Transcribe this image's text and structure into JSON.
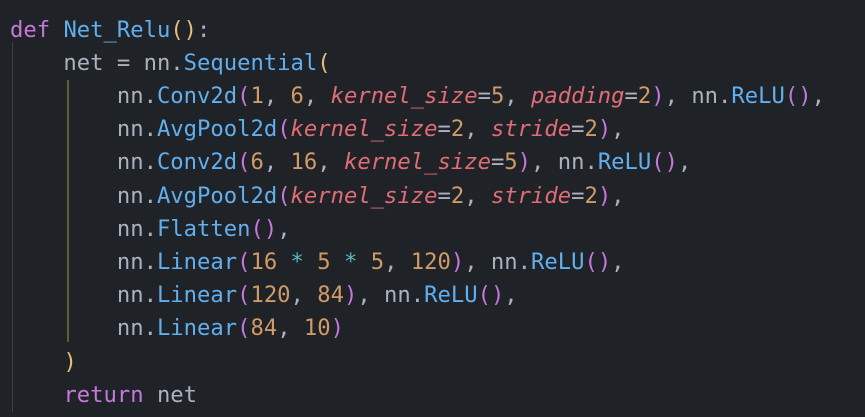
{
  "code": {
    "lines": [
      [
        {
          "t": "def",
          "c": "kw"
        },
        {
          "t": " ",
          "c": "id"
        },
        {
          "t": "Net_Relu",
          "c": "fn"
        },
        {
          "t": "(",
          "c": "b1"
        },
        {
          "t": ")",
          "c": "b1"
        },
        {
          "t": ":",
          "c": "punc"
        }
      ],
      [
        {
          "t": "    net = nn.",
          "c": "id"
        },
        {
          "t": "Sequential",
          "c": "fn"
        },
        {
          "t": "(",
          "c": "b1"
        }
      ],
      [
        {
          "t": "        nn.",
          "c": "id"
        },
        {
          "t": "Conv2d",
          "c": "fn"
        },
        {
          "t": "(",
          "c": "b2"
        },
        {
          "t": "1",
          "c": "num"
        },
        {
          "t": ", ",
          "c": "punc"
        },
        {
          "t": "6",
          "c": "num"
        },
        {
          "t": ", ",
          "c": "punc"
        },
        {
          "t": "kernel_size",
          "c": "kwarg"
        },
        {
          "t": "=",
          "c": "punc"
        },
        {
          "t": "5",
          "c": "num"
        },
        {
          "t": ", ",
          "c": "punc"
        },
        {
          "t": "padding",
          "c": "kwarg"
        },
        {
          "t": "=",
          "c": "punc"
        },
        {
          "t": "2",
          "c": "num"
        },
        {
          "t": ")",
          "c": "b2"
        },
        {
          "t": ", nn.",
          "c": "id"
        },
        {
          "t": "ReLU",
          "c": "fn"
        },
        {
          "t": "(",
          "c": "b2"
        },
        {
          "t": ")",
          "c": "b2"
        },
        {
          "t": ",",
          "c": "punc"
        }
      ],
      [
        {
          "t": "        nn.",
          "c": "id"
        },
        {
          "t": "AvgPool2d",
          "c": "fn"
        },
        {
          "t": "(",
          "c": "b2"
        },
        {
          "t": "kernel_size",
          "c": "kwarg"
        },
        {
          "t": "=",
          "c": "punc"
        },
        {
          "t": "2",
          "c": "num"
        },
        {
          "t": ", ",
          "c": "punc"
        },
        {
          "t": "stride",
          "c": "kwarg"
        },
        {
          "t": "=",
          "c": "punc"
        },
        {
          "t": "2",
          "c": "num"
        },
        {
          "t": ")",
          "c": "b2"
        },
        {
          "t": ",",
          "c": "punc"
        }
      ],
      [
        {
          "t": "        nn.",
          "c": "id"
        },
        {
          "t": "Conv2d",
          "c": "fn"
        },
        {
          "t": "(",
          "c": "b2"
        },
        {
          "t": "6",
          "c": "num"
        },
        {
          "t": ", ",
          "c": "punc"
        },
        {
          "t": "16",
          "c": "num"
        },
        {
          "t": ", ",
          "c": "punc"
        },
        {
          "t": "kernel_size",
          "c": "kwarg"
        },
        {
          "t": "=",
          "c": "punc"
        },
        {
          "t": "5",
          "c": "num"
        },
        {
          "t": ")",
          "c": "b2"
        },
        {
          "t": ", nn.",
          "c": "id"
        },
        {
          "t": "ReLU",
          "c": "fn"
        },
        {
          "t": "(",
          "c": "b2"
        },
        {
          "t": ")",
          "c": "b2"
        },
        {
          "t": ",",
          "c": "punc"
        }
      ],
      [
        {
          "t": "        nn.",
          "c": "id"
        },
        {
          "t": "AvgPool2d",
          "c": "fn"
        },
        {
          "t": "(",
          "c": "b2"
        },
        {
          "t": "kernel_size",
          "c": "kwarg"
        },
        {
          "t": "=",
          "c": "punc"
        },
        {
          "t": "2",
          "c": "num"
        },
        {
          "t": ", ",
          "c": "punc"
        },
        {
          "t": "stride",
          "c": "kwarg"
        },
        {
          "t": "=",
          "c": "punc"
        },
        {
          "t": "2",
          "c": "num"
        },
        {
          "t": ")",
          "c": "b2"
        },
        {
          "t": ",",
          "c": "punc"
        }
      ],
      [
        {
          "t": "        nn.",
          "c": "id"
        },
        {
          "t": "Flatten",
          "c": "fn"
        },
        {
          "t": "(",
          "c": "b2"
        },
        {
          "t": ")",
          "c": "b2"
        },
        {
          "t": ",",
          "c": "punc"
        }
      ],
      [
        {
          "t": "        nn.",
          "c": "id"
        },
        {
          "t": "Linear",
          "c": "fn"
        },
        {
          "t": "(",
          "c": "b2"
        },
        {
          "t": "16",
          "c": "num"
        },
        {
          "t": " ",
          "c": "punc"
        },
        {
          "t": "*",
          "c": "op"
        },
        {
          "t": " ",
          "c": "punc"
        },
        {
          "t": "5",
          "c": "num"
        },
        {
          "t": " ",
          "c": "punc"
        },
        {
          "t": "*",
          "c": "op"
        },
        {
          "t": " ",
          "c": "punc"
        },
        {
          "t": "5",
          "c": "num"
        },
        {
          "t": ", ",
          "c": "punc"
        },
        {
          "t": "120",
          "c": "num"
        },
        {
          "t": ")",
          "c": "b2"
        },
        {
          "t": ", nn.",
          "c": "id"
        },
        {
          "t": "ReLU",
          "c": "fn"
        },
        {
          "t": "(",
          "c": "b2"
        },
        {
          "t": ")",
          "c": "b2"
        },
        {
          "t": ",",
          "c": "punc"
        }
      ],
      [
        {
          "t": "        nn.",
          "c": "id"
        },
        {
          "t": "Linear",
          "c": "fn"
        },
        {
          "t": "(",
          "c": "b2"
        },
        {
          "t": "120",
          "c": "num"
        },
        {
          "t": ", ",
          "c": "punc"
        },
        {
          "t": "84",
          "c": "num"
        },
        {
          "t": ")",
          "c": "b2"
        },
        {
          "t": ", nn.",
          "c": "id"
        },
        {
          "t": "ReLU",
          "c": "fn"
        },
        {
          "t": "(",
          "c": "b2"
        },
        {
          "t": ")",
          "c": "b2"
        },
        {
          "t": ",",
          "c": "punc"
        }
      ],
      [
        {
          "t": "        nn.",
          "c": "id"
        },
        {
          "t": "Linear",
          "c": "fn"
        },
        {
          "t": "(",
          "c": "b2"
        },
        {
          "t": "84",
          "c": "num"
        },
        {
          "t": ", ",
          "c": "punc"
        },
        {
          "t": "10",
          "c": "num"
        },
        {
          "t": ")",
          "c": "b2"
        }
      ],
      [
        {
          "t": "    ",
          "c": "id"
        },
        {
          "t": ")",
          "c": "b1"
        }
      ],
      [
        {
          "t": "    ",
          "c": "id"
        },
        {
          "t": "return",
          "c": "kw"
        },
        {
          "t": " net",
          "c": "id"
        }
      ]
    ]
  },
  "theme": {
    "background": "#1f2227",
    "keyword": "#c678dd",
    "function": "#61afef",
    "identifier": "#abb2bf",
    "number": "#d19a66",
    "operator": "#56b6c2",
    "kwarg": "#e06c75",
    "bracket_level1": "#e5c07b",
    "bracket_level2": "#c678dd"
  }
}
